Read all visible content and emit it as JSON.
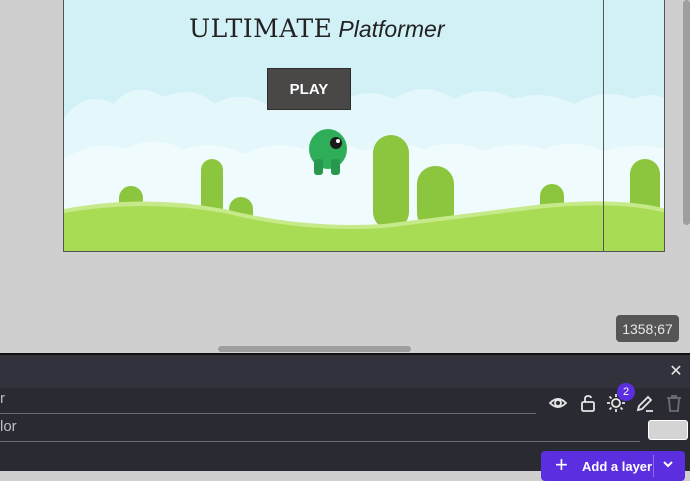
{
  "game": {
    "title_main": "ULTIMATE",
    "title_sub": "Platformer",
    "play_label": "PLAY"
  },
  "canvas": {
    "coordinates": "1358;67"
  },
  "layers_panel": {
    "layer_name_fragment": "r",
    "color_label_fragment": "lor",
    "lights_badge_count": "2",
    "add_layer_label": "Add a layer",
    "background_color": "#d4d4d4"
  },
  "icons": {
    "close": "close-icon",
    "visibility": "eye-icon",
    "lock": "unlock-icon",
    "lights": "sun-icon",
    "edit": "pencil-icon",
    "delete": "trash-icon",
    "add": "plus-icon",
    "dropdown": "chevron-down-icon"
  },
  "colors": {
    "accent": "#5b2fe0",
    "grass": "#8cc63f",
    "grass_light": "#a8dc55",
    "sky": "#d6f3f8",
    "player": "#2fae5a"
  }
}
